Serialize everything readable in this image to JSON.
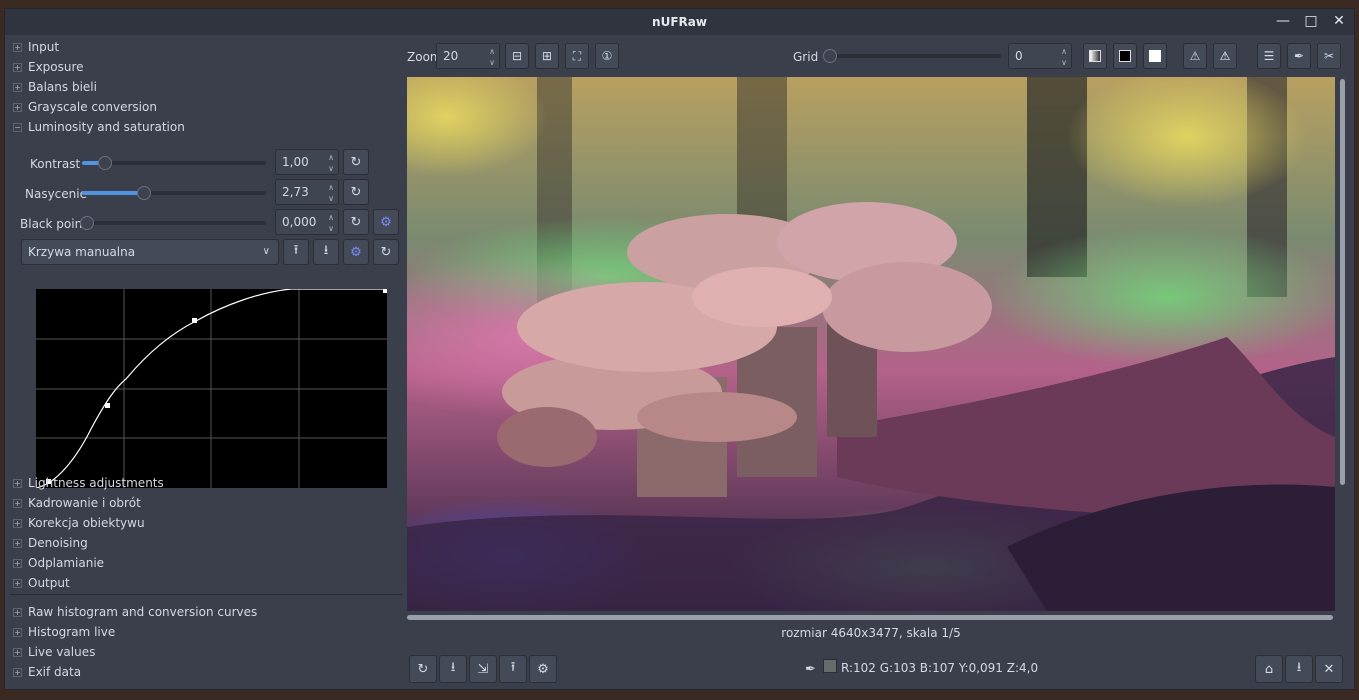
{
  "window": {
    "title": "nUFRaw"
  },
  "left_panel": {
    "sections_top": [
      {
        "label": "Input",
        "toggle": "+"
      },
      {
        "label": "Exposure",
        "toggle": "+"
      },
      {
        "label": "Balans bieli",
        "toggle": "+"
      },
      {
        "label": "Grayscale conversion",
        "toggle": "+"
      },
      {
        "label": "Luminosity and saturation",
        "toggle": "−"
      }
    ],
    "kontrast": {
      "label": "Kontrast",
      "value": "1,00",
      "level": 0.07
    },
    "nasycenie": {
      "label": "Nasycenie",
      "value": "2,73",
      "level": 0.35
    },
    "black_point": {
      "label": "Black point",
      "value": "0,000",
      "level": 0.0
    },
    "curve_select": {
      "value": "Krzywa manualna"
    },
    "sections_bottom": [
      {
        "label": "Lightness adjustments",
        "toggle": "+"
      },
      {
        "label": "Kadrowanie i obrót",
        "toggle": "+"
      },
      {
        "label": "Korekcja obiektywu",
        "toggle": "+"
      },
      {
        "label": "Denoising",
        "toggle": "+"
      },
      {
        "label": "Odplamianie",
        "toggle": "+"
      },
      {
        "label": "Output",
        "toggle": "+"
      }
    ],
    "sections_lower": [
      {
        "label": "Raw histogram and conversion curves",
        "toggle": "+"
      },
      {
        "label": "Histogram live",
        "toggle": "+"
      },
      {
        "label": "Live values",
        "toggle": "+"
      },
      {
        "label": "Exif data",
        "toggle": "+"
      }
    ]
  },
  "toolbar": {
    "zoom_label": "Zoom",
    "zoom_value": "20",
    "grid_label": "Grid",
    "grid_value": "0"
  },
  "status": {
    "image_info": "rozmiar 4640x3477, skala 1/5",
    "pixel_values": "R:102 G:103 B:107 Y:0,091 Z:4,0"
  },
  "colors": {
    "accent": "#5294e2",
    "background": "#3a3f4b"
  }
}
